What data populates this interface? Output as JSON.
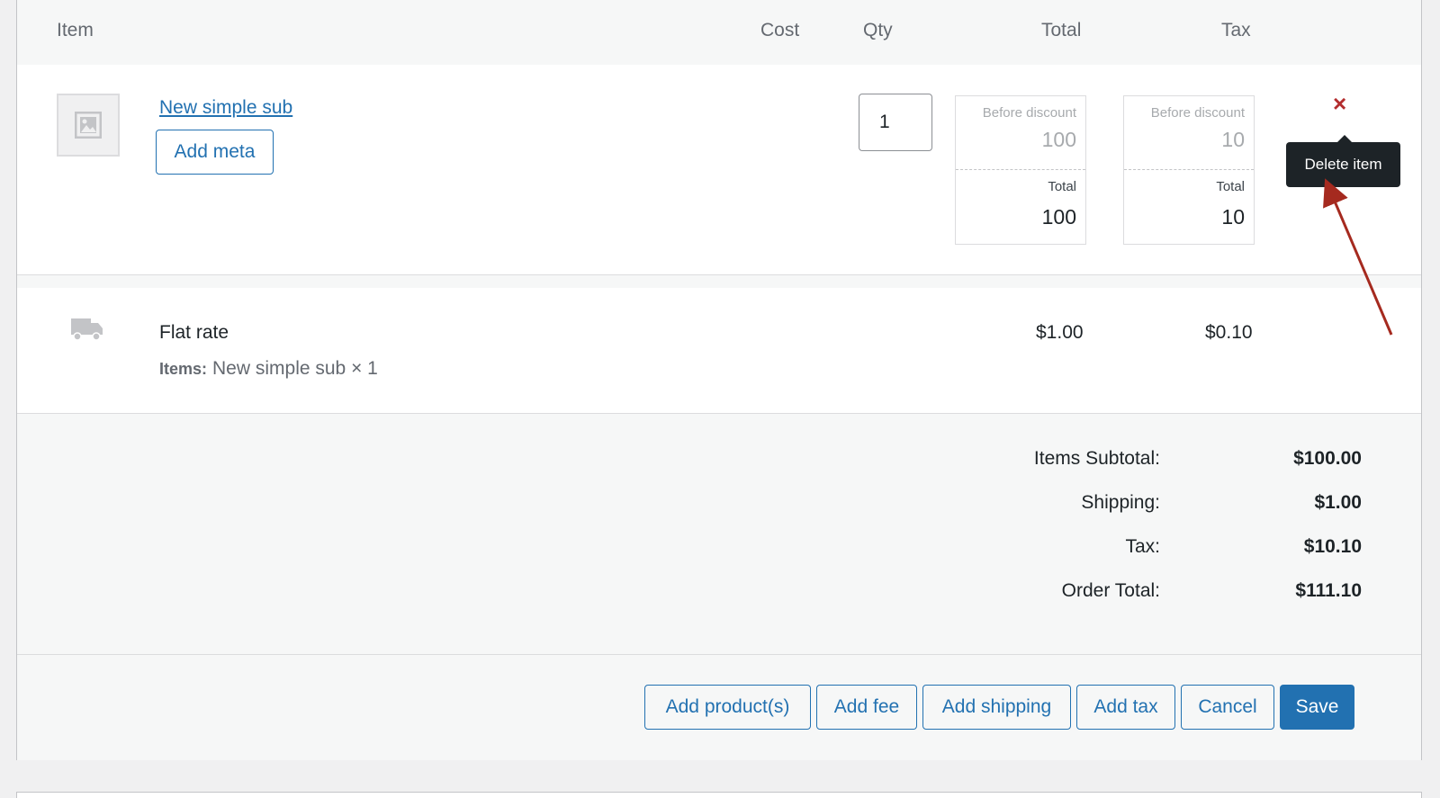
{
  "columns": {
    "item": "Item",
    "cost": "Cost",
    "qty": "Qty",
    "total": "Total",
    "tax": "Tax"
  },
  "line_item": {
    "name": "New simple sub",
    "add_meta_label": "Add meta",
    "qty": "1",
    "total": {
      "before_label": "Before discount",
      "before_value": "100",
      "total_label": "Total",
      "total_value": "100"
    },
    "tax": {
      "before_label": "Before discount",
      "before_value": "10",
      "total_label": "Total",
      "total_value": "10"
    },
    "delete_symbol": "×",
    "tooltip": "Delete item",
    "thumbnail_icon": "image-placeholder-icon"
  },
  "shipping_line": {
    "icon": "truck-icon",
    "name": "Flat rate",
    "items_label": "Items:",
    "items_value": "New simple sub × 1",
    "total": "$1.00",
    "tax": "$0.10"
  },
  "totals": [
    {
      "label": "Items Subtotal:",
      "value": "$100.00"
    },
    {
      "label": "Shipping:",
      "value": "$1.00"
    },
    {
      "label": "Tax:",
      "value": "$10.10"
    },
    {
      "label": "Order Total:",
      "value": "$111.10"
    }
  ],
  "actions": {
    "add_products": "Add product(s)",
    "add_fee": "Add fee",
    "add_shipping": "Add shipping",
    "add_tax": "Add tax",
    "cancel": "Cancel",
    "save": "Save"
  },
  "colors": {
    "accent": "#2271b1",
    "delete": "#b32d2e",
    "annotation_arrow": "#a52a1f"
  }
}
